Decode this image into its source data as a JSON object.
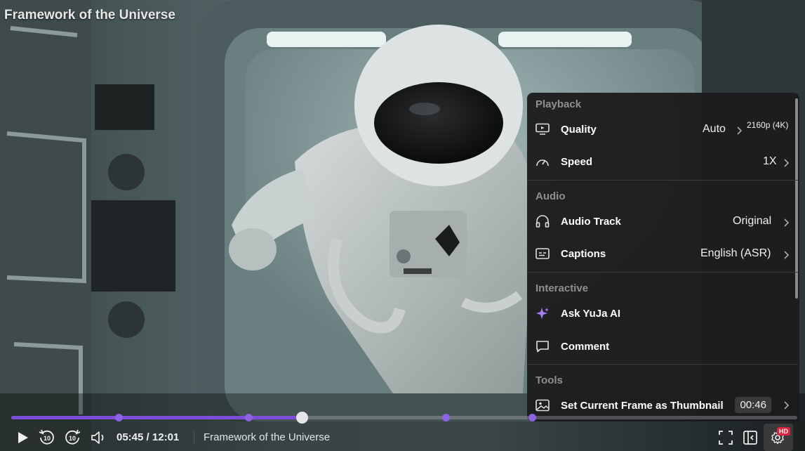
{
  "video": {
    "title": "Framework of the Universe",
    "current_time": "05:45",
    "separator": "/",
    "duration": "12:01",
    "progress": 0.37,
    "chapter_markers": [
      0.137,
      0.302,
      0.553,
      0.663
    ]
  },
  "settings": {
    "sections": {
      "playback": "Playback",
      "audio": "Audio",
      "interactive": "Interactive",
      "tools": "Tools"
    },
    "quality": {
      "label": "Quality",
      "value": "Auto",
      "resolution": "2160p (4K)"
    },
    "speed": {
      "label": "Speed",
      "value": "1X"
    },
    "audio_track": {
      "label": "Audio Track",
      "value": "Original"
    },
    "captions": {
      "label": "Captions",
      "value": "English (ASR)"
    },
    "ask_ai": {
      "label": "Ask YuJa AI"
    },
    "comment": {
      "label": "Comment"
    },
    "thumbnail": {
      "label": "Set Current Frame as Thumbnail",
      "timestamp": "00:46"
    }
  },
  "controls": {
    "rewind_seconds": "10",
    "forward_seconds": "10",
    "hd_badge": "HD"
  },
  "colors": {
    "accent": "#7c4dd8",
    "panel_bg": "#1c1c1e",
    "ai_icon": "#a77ef0",
    "hd_badge": "#d9223c"
  },
  "icons": {
    "play": "play-icon",
    "rewind": "rewind-10-icon",
    "forward": "forward-10-icon",
    "volume": "volume-icon",
    "fullscreen": "fullscreen-icon",
    "sidebar": "sidebar-toggle-icon",
    "settings": "gear-icon"
  }
}
